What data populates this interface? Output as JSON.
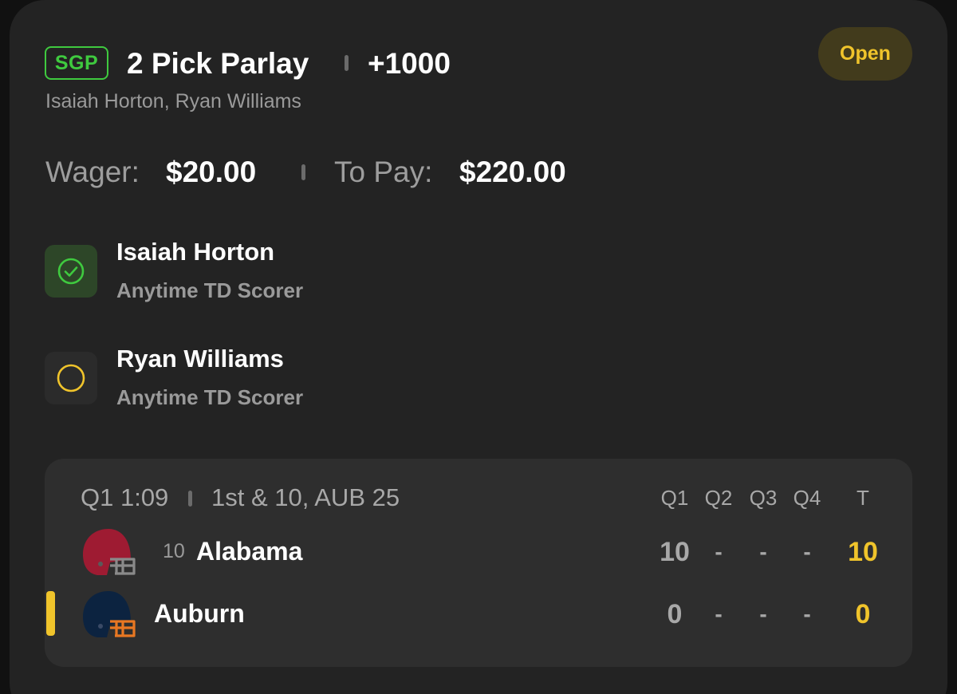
{
  "bet": {
    "badge": "SGP",
    "title": "2 Pick Parlay",
    "odds": "+1000",
    "status": "Open",
    "participants": "Isaiah Horton, Ryan Williams",
    "wager_label": "Wager:",
    "wager_value": "$20.00",
    "topay_label": "To Pay:",
    "topay_value": "$220.00"
  },
  "legs": [
    {
      "player": "Isaiah Horton",
      "market": "Anytime TD Scorer",
      "state": "won"
    },
    {
      "player": "Ryan Williams",
      "market": "Anytime TD Scorer",
      "state": "pending"
    }
  ],
  "game": {
    "clock": "Q1 1:09",
    "situation": "1st & 10, AUB 25",
    "columns": [
      "Q1",
      "Q2",
      "Q3",
      "Q4",
      "T"
    ],
    "teams": [
      {
        "rank": "10",
        "name": "Alabama",
        "scores": [
          "10",
          "-",
          "-",
          "-"
        ],
        "total": "10",
        "helmet_color": "#9e1b32",
        "facemask_color": "#8a8a8a",
        "possession": false
      },
      {
        "rank": "",
        "name": "Auburn",
        "scores": [
          "0",
          "-",
          "-",
          "-"
        ],
        "total": "0",
        "helmet_color": "#0c2340",
        "facemask_color": "#e87722",
        "possession": true
      }
    ]
  },
  "colors": {
    "accent_green": "#3fca3f",
    "accent_yellow": "#f0c42b"
  }
}
